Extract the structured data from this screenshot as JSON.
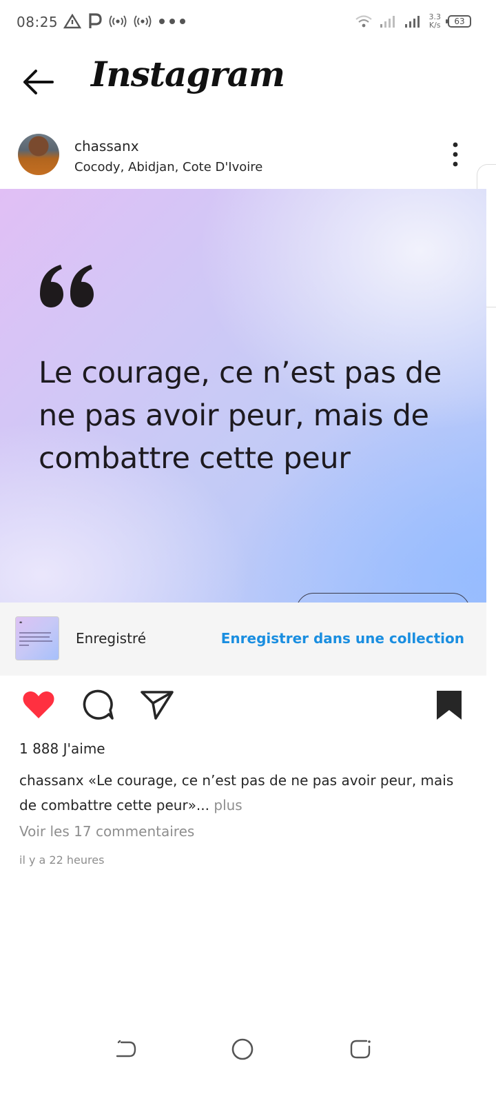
{
  "status_bar": {
    "time": "08:25",
    "network_speed_value": "3.3",
    "network_speed_unit": "K/s",
    "battery": "63",
    "left_icons": [
      "triangle-icon",
      "parking-p-icon",
      "hotspot-icon",
      "hotspot-icon",
      "more-dots-icon"
    ],
    "right_icons": [
      "wifi-icon",
      "signal-icon",
      "signal-icon",
      "battery-icon"
    ]
  },
  "header": {
    "title": "Instagram"
  },
  "post": {
    "username": "chassanx",
    "location": "Cocody, Abidjan, Cote D'Ivoire",
    "quote_text": "Le courage, ce n’est pas de ne pas avoir peur, mais de combattre cette peur"
  },
  "saved_bar": {
    "label": "Enregistré",
    "action": "Enregistrer dans une collection"
  },
  "engagement": {
    "likes": "1 888 J'aime",
    "caption_user": "chassanx",
    "caption_text": " «Le courage, ce n’est pas de ne pas avoir peur, mais de combattre cette peur»...",
    "caption_more": " plus",
    "comments_link": "Voir les 17 commentaires",
    "timestamp": "il y a 22 heures"
  },
  "colors": {
    "like_red": "#ff3040",
    "link_blue": "#1a8ee0",
    "muted_gray": "#8e8e8e"
  }
}
